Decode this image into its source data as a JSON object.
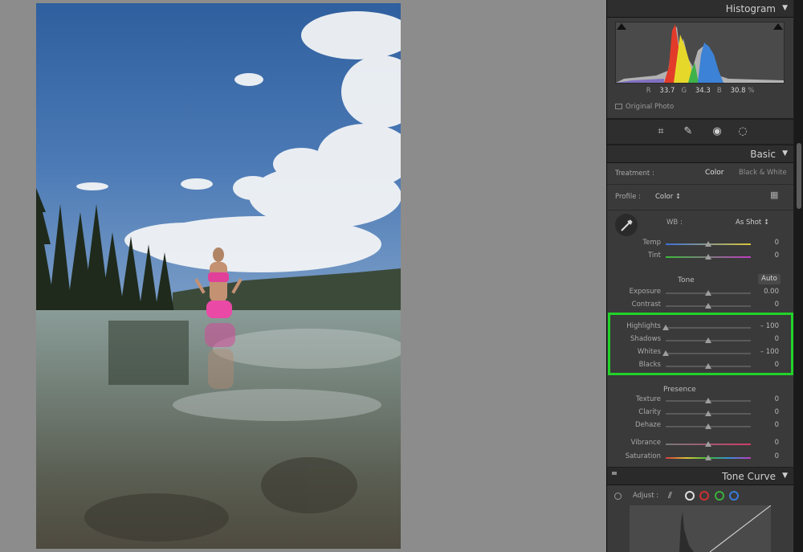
{
  "histogram": {
    "title": "Histogram",
    "r_label": "R",
    "r_value": "33.7",
    "g_label": "G",
    "g_value": "34.3",
    "b_label": "B",
    "b_value": "30.8",
    "percent": "%",
    "original_photo": "Original Photo"
  },
  "tools": [
    "crop-icon",
    "heal-icon",
    "redeye-icon",
    "mask-icon"
  ],
  "basic": {
    "title": "Basic",
    "treatment_label": "Treatment :",
    "treatment_color": "Color",
    "treatment_bw": "Black & White",
    "profile_label": "Profile :",
    "profile_value": "Color ↕",
    "wb_label": "WB :",
    "wb_value": "As Shot ↕",
    "tone_label": "Tone",
    "auto_label": "Auto",
    "presence_label": "Presence",
    "sliders": {
      "temp": {
        "label": "Temp",
        "value": "0",
        "level": 0.5
      },
      "tint": {
        "label": "Tint",
        "value": "0",
        "level": 0.5
      },
      "exposure": {
        "label": "Exposure",
        "value": "0.00",
        "level": 0.5
      },
      "contrast": {
        "label": "Contrast",
        "value": "0",
        "level": 0.5
      },
      "highlights": {
        "label": "Highlights",
        "value": "– 100",
        "level": 0.0
      },
      "shadows": {
        "label": "Shadows",
        "value": "0",
        "level": 0.5
      },
      "whites": {
        "label": "Whites",
        "value": "– 100",
        "level": 0.0
      },
      "blacks": {
        "label": "Blacks",
        "value": "0",
        "level": 0.5
      },
      "texture": {
        "label": "Texture",
        "value": "0",
        "level": 0.5
      },
      "clarity": {
        "label": "Clarity",
        "value": "0",
        "level": 0.5
      },
      "dehaze": {
        "label": "Dehaze",
        "value": "0",
        "level": 0.5
      },
      "vibrance": {
        "label": "Vibrance",
        "value": "0",
        "level": 0.5
      },
      "saturation": {
        "label": "Saturation",
        "value": "0",
        "level": 0.5
      }
    }
  },
  "tone_curve": {
    "title": "Tone Curve",
    "adjust_label": "Adjust :"
  },
  "colors": {
    "highlight_box": "#22d22a",
    "panel_bg": "#3a3a3a"
  }
}
